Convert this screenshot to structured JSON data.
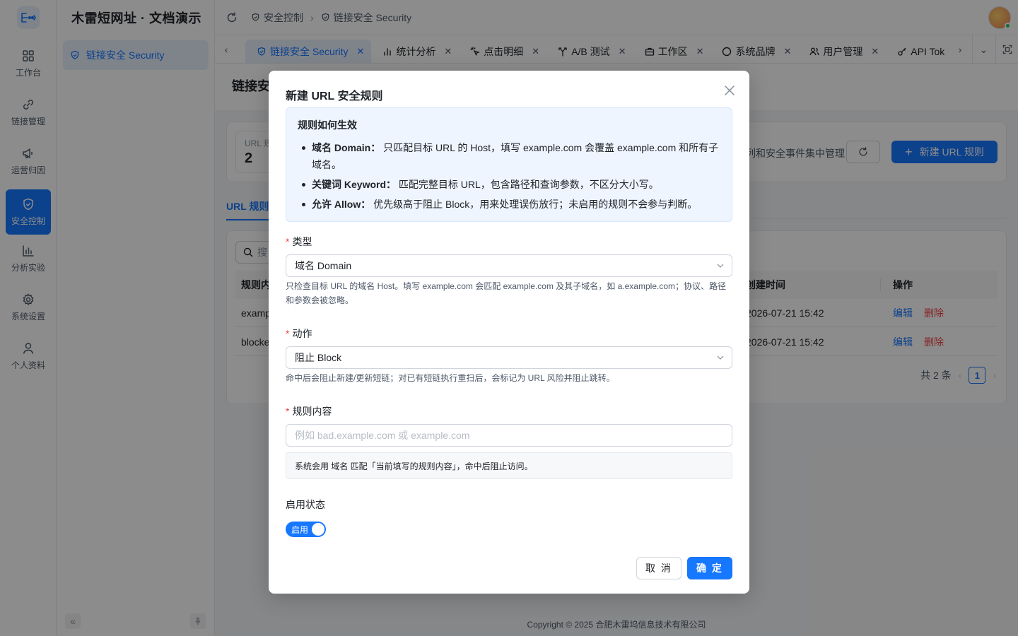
{
  "rail": {
    "items": [
      {
        "label": "工作台",
        "icon": "dashboard-icon"
      },
      {
        "label": "链接管理",
        "icon": "link-icon"
      },
      {
        "label": "运营归因",
        "icon": "megaphone-icon"
      },
      {
        "label": "安全控制",
        "icon": "shield-icon",
        "active": true
      },
      {
        "label": "分析实验",
        "icon": "bar-chart-icon"
      },
      {
        "label": "系统设置",
        "icon": "gear-icon"
      },
      {
        "label": "个人资料",
        "icon": "user-icon"
      }
    ]
  },
  "subbar": {
    "brand": "木雷短网址 · 文档演示",
    "active_item": "链接安全 Security"
  },
  "header": {
    "breadcrumbs": [
      "安全控制",
      "链接安全 Security"
    ]
  },
  "tabs": [
    {
      "label": "链接安全 Security",
      "icon": "shield-icon",
      "active": true
    },
    {
      "label": "统计分析",
      "icon": "bar-chart-icon"
    },
    {
      "label": "点击明细",
      "icon": "click-icon"
    },
    {
      "label": "A/B 测试",
      "icon": "split-icon"
    },
    {
      "label": "工作区",
      "icon": "briefcase-icon"
    },
    {
      "label": "系统品牌",
      "icon": "circle-icon"
    },
    {
      "label": "用户管理",
      "icon": "users-icon"
    },
    {
      "label": "API Tok",
      "icon": "key-icon"
    }
  ],
  "page": {
    "title": "链接安全",
    "stat_label": "URL 规",
    "stat_value": "2",
    "desc_tail": "列和安全事件集中管理",
    "new_rule_button": "新建 URL 规则",
    "url_tab": "URL 规则",
    "search_placeholder": "搜",
    "columns": {
      "rule": "规则内",
      "created": "创建时间",
      "ops": "操作"
    },
    "rows": [
      {
        "rule": "examp",
        "created": "2026-07-21 15:42",
        "edit": "编辑",
        "delete": "删除"
      },
      {
        "rule": "blocke",
        "created": "2026-07-21 15:42",
        "edit": "编辑",
        "delete": "删除"
      }
    ],
    "total": "共 2 条",
    "current_page": "1",
    "footer": "Copyright © 2025 合肥木雷坞信息技术有限公司"
  },
  "modal": {
    "title": "新建 URL 安全规则",
    "info_title": "规则如何生效",
    "info_items": [
      {
        "term": "域名 Domain：",
        "text": "只匹配目标 URL 的 Host，填写 example.com 会覆盖 example.com 和所有子域名。"
      },
      {
        "term": "关键词 Keyword：",
        "text": "匹配完整目标 URL，包含路径和查询参数，不区分大小写。"
      },
      {
        "term": "允许 Allow：",
        "text": "优先级高于阻止 Block，用来处理误伤放行；未启用的规则不会参与判断。"
      }
    ],
    "type_label": "类型",
    "type_value": "域名 Domain",
    "type_hint": "只检查目标 URL 的域名 Host。填写 example.com 会匹配 example.com 及其子域名，如 a.example.com；协议、路径和参数会被忽略。",
    "action_label": "动作",
    "action_value": "阻止 Block",
    "action_hint": "命中后会阻止新建/更新短链；对已有短链执行重扫后，会标记为 URL 风险并阻止跳转。",
    "content_label": "规则内容",
    "content_placeholder": "例如 bad.example.com 或 example.com",
    "content_value": "",
    "preview": "系统会用 域名 匹配「当前填写的规则内容」，命中后阻止访问。",
    "status_label": "启用状态",
    "switch_text": "启用",
    "switch_on": true,
    "cancel": "取 消",
    "ok": "确 定"
  },
  "colors": {
    "primary": "#1677ff",
    "danger": "#f53f3f",
    "required": "#f53f3f"
  }
}
